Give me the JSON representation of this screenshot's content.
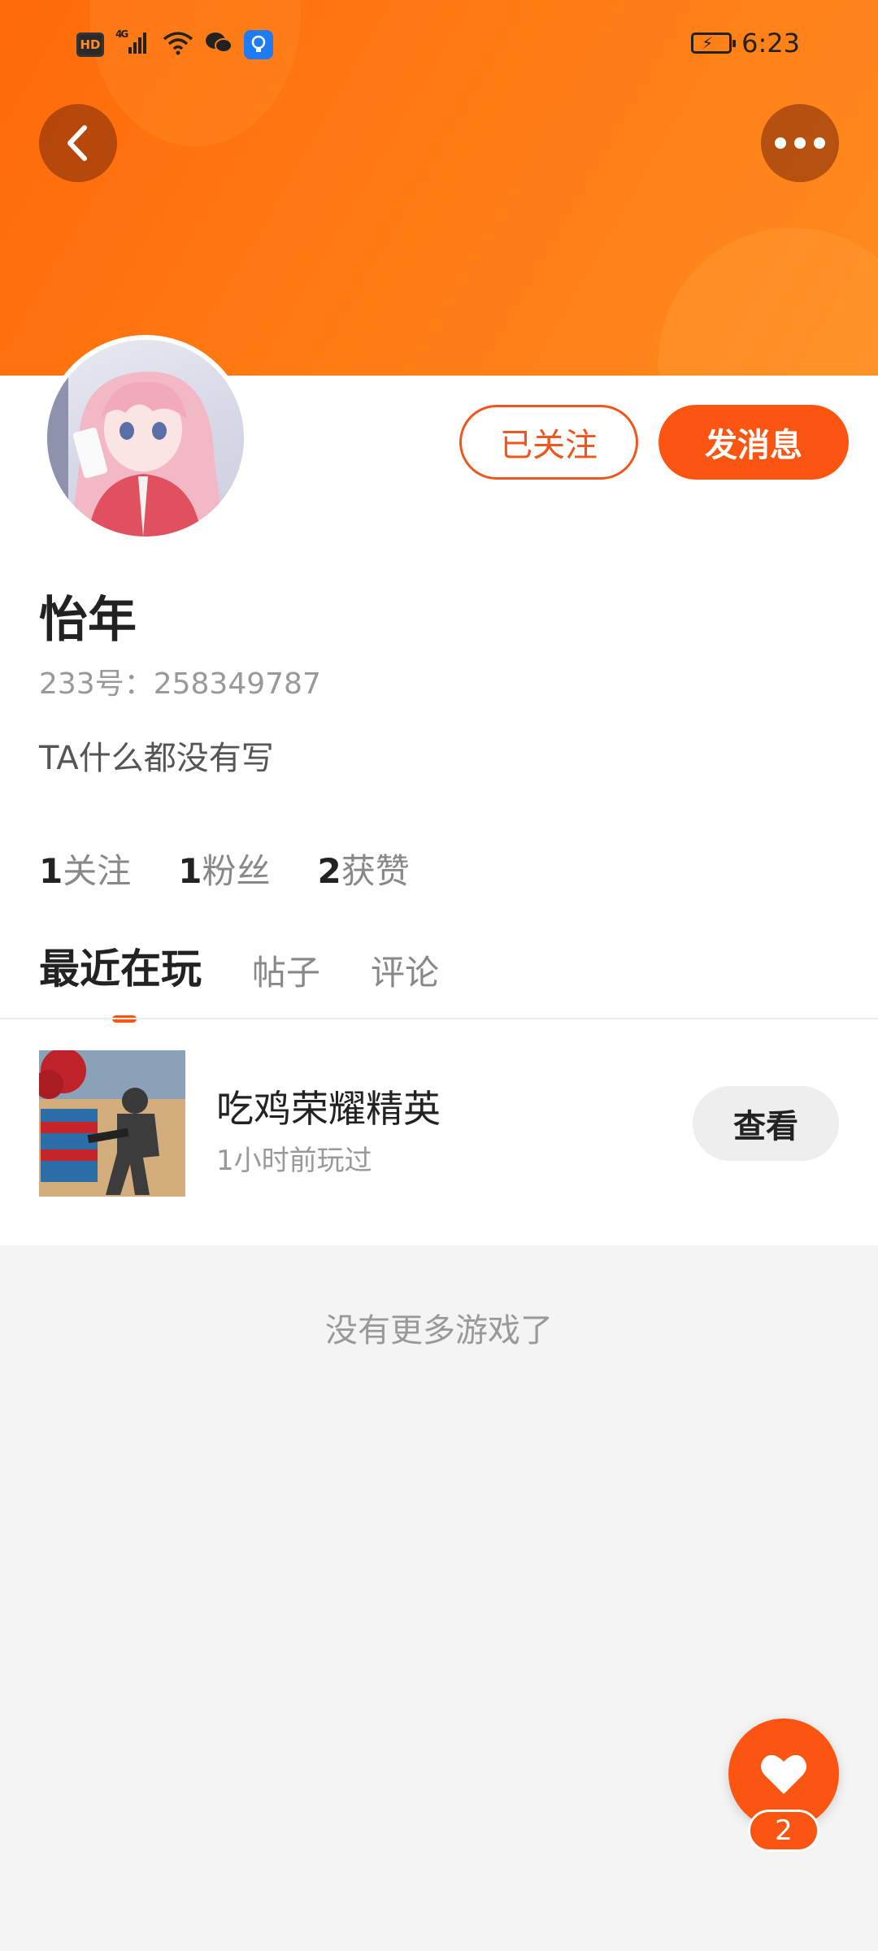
{
  "status_bar": {
    "hd": "HD",
    "network": "4G",
    "time": "6:23"
  },
  "header": {
    "back_icon": "chevron-left-icon",
    "more_icon": "more-horizontal-icon",
    "gradient_from": "#ff6a0a",
    "gradient_to": "#ff8a1e"
  },
  "profile": {
    "name": "怡年",
    "uid": "233号：258349787",
    "bio": "TA什么都没有写",
    "follow_button": "已关注",
    "message_button": "发消息"
  },
  "stats": [
    {
      "num": "1",
      "label": "关注"
    },
    {
      "num": "1",
      "label": "粉丝"
    },
    {
      "num": "2",
      "label": "获赞"
    }
  ],
  "tabs": [
    {
      "label": "最近在玩",
      "active": true
    },
    {
      "label": "帖子",
      "active": false
    },
    {
      "label": "评论",
      "active": false
    }
  ],
  "recent_game": {
    "title": "吃鸡荣耀精英",
    "subtitle": "1小时前玩过",
    "view_button": "查看"
  },
  "empty_text": "没有更多游戏了",
  "fab": {
    "icon": "heart-icon",
    "count": "2"
  },
  "accent_color": "#fb5511"
}
